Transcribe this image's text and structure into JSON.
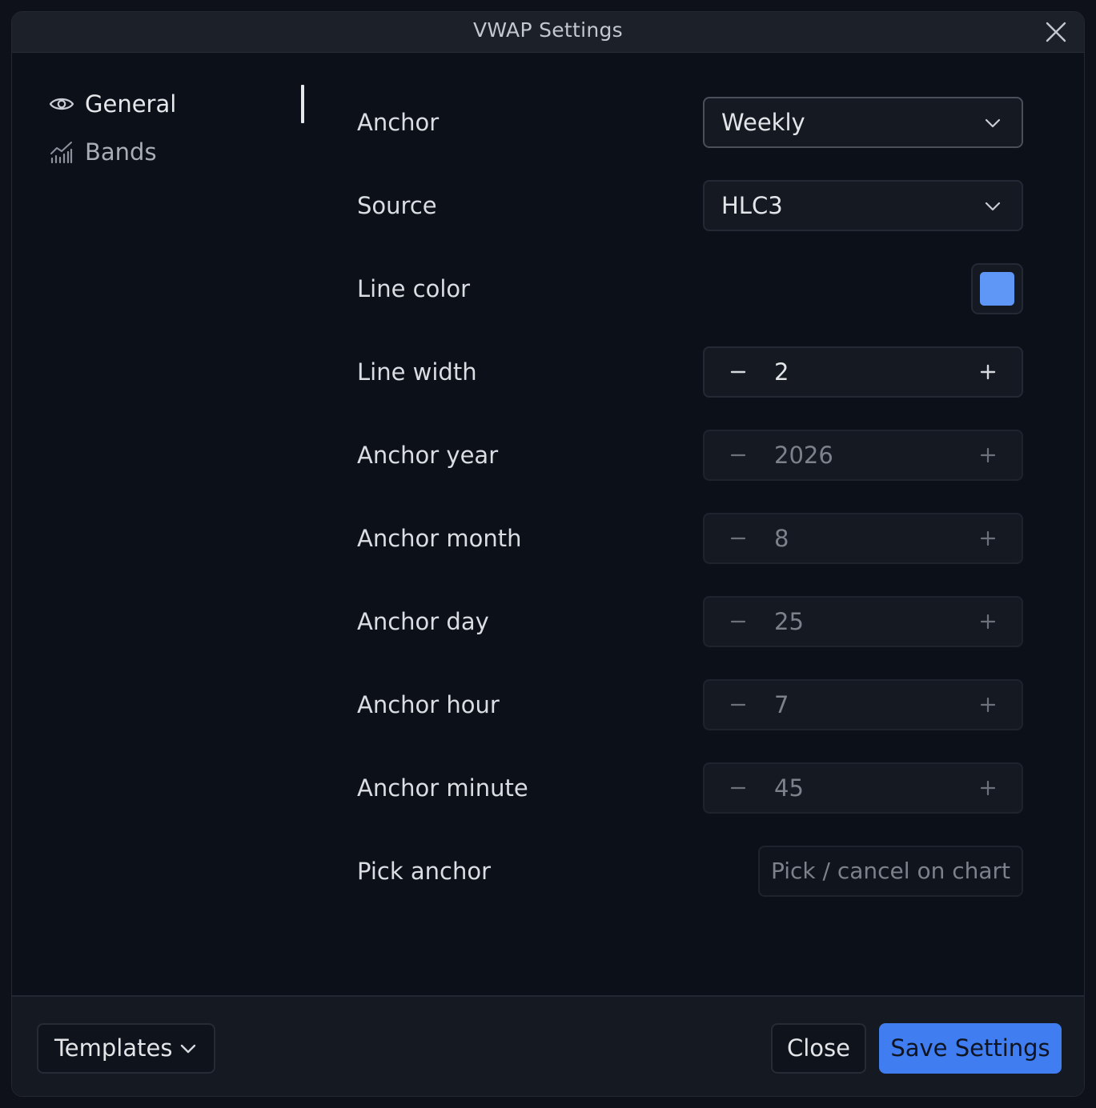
{
  "dialog": {
    "title": "VWAP Settings",
    "close_icon": "close-icon"
  },
  "sidebar": {
    "items": [
      {
        "label": "General",
        "icon": "eye-icon",
        "active": true
      },
      {
        "label": "Bands",
        "icon": "chart-bars-icon",
        "active": false
      }
    ]
  },
  "settings": {
    "anchor": {
      "label": "Anchor",
      "value": "Weekly"
    },
    "source": {
      "label": "Source",
      "value": "HLC3"
    },
    "line_color": {
      "label": "Line color",
      "color": "#5f97f6"
    },
    "line_width": {
      "label": "Line width",
      "value": "2",
      "enabled": true
    },
    "anchor_year": {
      "label": "Anchor year",
      "value": "2026",
      "enabled": false
    },
    "anchor_month": {
      "label": "Anchor month",
      "value": "8",
      "enabled": false
    },
    "anchor_day": {
      "label": "Anchor day",
      "value": "25",
      "enabled": false
    },
    "anchor_hour": {
      "label": "Anchor hour",
      "value": "7",
      "enabled": false
    },
    "anchor_minute": {
      "label": "Anchor minute",
      "value": "45",
      "enabled": false
    },
    "pick_anchor": {
      "label": "Pick anchor",
      "button": "Pick / cancel on chart",
      "enabled": false
    }
  },
  "footer": {
    "templates_label": "Templates",
    "close_label": "Close",
    "save_label": "Save Settings"
  },
  "colors": {
    "accent": "#3f7df0",
    "background": "#0c1018",
    "titlebar": "#1c2029"
  }
}
